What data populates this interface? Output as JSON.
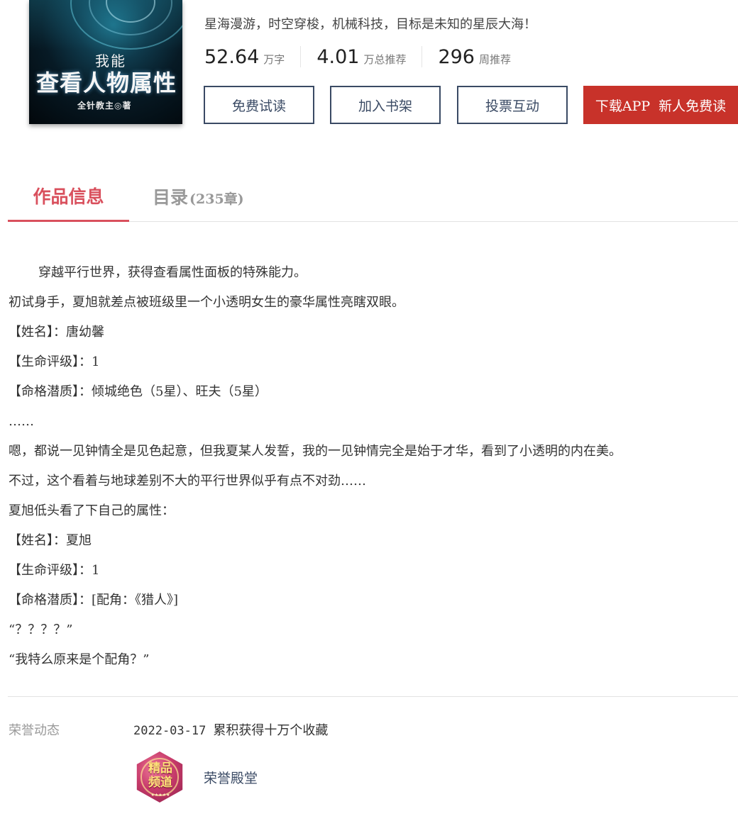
{
  "book": {
    "cover": {
      "title_top": "我能",
      "title_main": "查看人物属性",
      "author_line": "全针教主◎著"
    },
    "intro": "星海漫游，时空穿梭，机械科技，目标是未知的星辰大海！",
    "stats": [
      {
        "value": "52.64",
        "unit": "万字"
      },
      {
        "value": "4.01",
        "unit": "万总推荐"
      },
      {
        "value": "296",
        "unit": "周推荐"
      }
    ],
    "actions": {
      "free_read": "免费试读",
      "add_shelf": "加入书架",
      "vote": "投票互动",
      "app_download": "下载APP",
      "app_promo": "新人免费读"
    }
  },
  "tabs": {
    "info": "作品信息",
    "catalog": "目录",
    "catalog_count": "(235章)"
  },
  "description": [
    "穿越平行世界，获得查看属性面板的特殊能力。",
    "初试身手，夏旭就差点被班级里一个小透明女生的豪华属性亮瞎双眼。",
    "【姓名】：唐幼馨",
    "【生命评级】：1",
    "【命格潜质】：倾城绝色（5星）、旺夫（5星）",
    "……",
    "嗯，都说一见钟情全是见色起意，但我夏某人发誓，我的一见钟情完全是始于才华，看到了小透明的内在美。",
    "不过，这个看着与地球差别不大的平行世界似乎有点不对劲……",
    "夏旭低头看了下自己的属性：",
    "【姓名】：夏旭",
    "【生命评级】：1",
    "【命格潜质】：[配角：《猎人》]",
    "“？？？？”",
    "“我特么原来是个配角？”"
  ],
  "honors": {
    "label": "荣誉动态",
    "date": "2022-03-17",
    "event": "累积获得十万个收藏",
    "badge_text_line1": "精品",
    "badge_text_line2": "频道",
    "badge_stars": "★★★★★",
    "badge_label": "荣誉殿堂",
    "badge_color": "#c63a6a"
  },
  "colors": {
    "accent": "#d9505d",
    "button_border": "#3a4a64",
    "app_button": "#c8322a"
  }
}
